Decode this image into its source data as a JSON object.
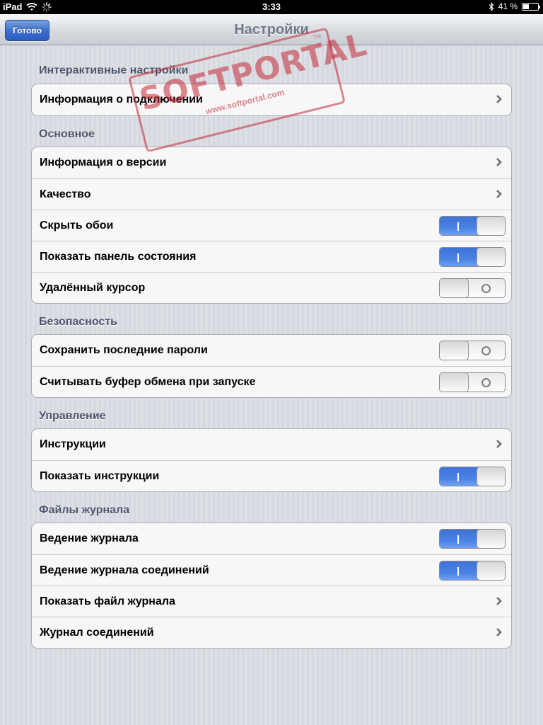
{
  "status_bar": {
    "device": "iPad",
    "time": "3:33",
    "battery_text": "41 %",
    "battery_level": 0.41,
    "icons": [
      "wifi-icon",
      "activity-spinner-icon",
      "bluetooth-icon",
      "battery-icon"
    ]
  },
  "nav": {
    "title": "Настройки",
    "done_label": "Готово"
  },
  "watermark": {
    "brand": "SOFTPORTAL",
    "url": "www.softportal.com",
    "tm": "TM"
  },
  "sections": [
    {
      "header": "Интерактивные настройки",
      "rows": [
        {
          "label": "Информация о подключении",
          "type": "disclosure"
        }
      ]
    },
    {
      "header": "Основное",
      "rows": [
        {
          "label": "Информация о версии",
          "type": "disclosure"
        },
        {
          "label": "Качество",
          "type": "disclosure"
        },
        {
          "label": "Скрыть обои",
          "type": "switch",
          "on": true
        },
        {
          "label": "Показать панель состояния",
          "type": "switch",
          "on": true
        },
        {
          "label": "Удалённый курсор",
          "type": "switch",
          "on": false
        }
      ]
    },
    {
      "header": "Безопасность",
      "rows": [
        {
          "label": "Сохранить последние пароли",
          "type": "switch",
          "on": false
        },
        {
          "label": "Считывать буфер обмена при запуске",
          "type": "switch",
          "on": false
        }
      ]
    },
    {
      "header": "Управление",
      "rows": [
        {
          "label": "Инструкции",
          "type": "disclosure"
        },
        {
          "label": "Показать инструкции",
          "type": "switch",
          "on": true
        }
      ]
    },
    {
      "header": "Файлы журнала",
      "rows": [
        {
          "label": "Ведение журнала",
          "type": "switch",
          "on": true
        },
        {
          "label": "Ведение журнала соединений",
          "type": "switch",
          "on": true
        },
        {
          "label": "Показать файл журнала",
          "type": "disclosure"
        },
        {
          "label": "Журнал соединений",
          "type": "disclosure"
        }
      ]
    }
  ],
  "colors": {
    "switch_on": "#4a82e4",
    "header_text": "#4c566c",
    "nav_button": "#3f6fcc"
  }
}
